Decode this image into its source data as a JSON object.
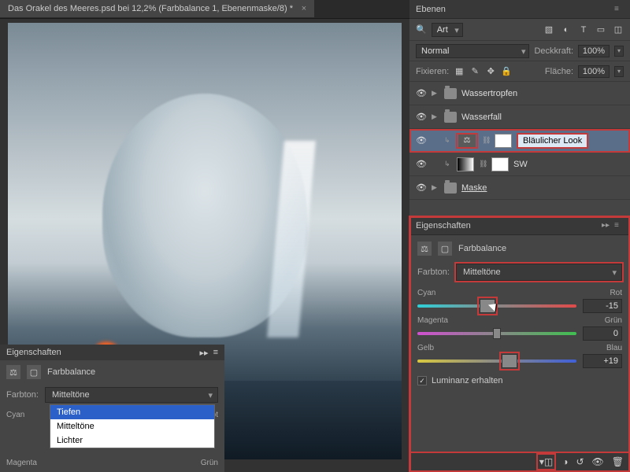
{
  "doc": {
    "title": "Das Orakel des Meeres.psd bei 12,2% (Farbbalance 1, Ebenenmaske/8) *",
    "close": "×"
  },
  "layers": {
    "panel_title": "Ebenen",
    "kind_dd": "Art",
    "blend": "Normal",
    "opacity_lbl": "Deckkraft:",
    "opacity": "100%",
    "lock_lbl": "Fixieren:",
    "fill_lbl": "Fläche:",
    "fill": "100%",
    "items": [
      {
        "name": "Wassertropfen"
      },
      {
        "name": "Wasserfall"
      },
      {
        "name": "Bläulicher Look"
      },
      {
        "name": "SW"
      },
      {
        "name": "Maske"
      }
    ]
  },
  "props": {
    "panel_title": "Eigenschaften",
    "adj_title": "Farbbalance",
    "tone_lbl": "Farbton:",
    "tone_val": "Mitteltöne",
    "sliders": [
      {
        "left": "Cyan",
        "right": "Rot",
        "val": "-15",
        "pos": 44,
        "track": "t-cyan",
        "red": true,
        "cursor": true
      },
      {
        "left": "Magenta",
        "right": "Grün",
        "val": "0",
        "pos": 50,
        "track": "t-mag"
      },
      {
        "left": "Gelb",
        "right": "Blau",
        "val": "+19",
        "pos": 58,
        "track": "t-yel",
        "red": true
      }
    ],
    "lum": "Luminanz erhalten"
  },
  "bl": {
    "panel_title": "Eigenschaften",
    "adj_title": "Farbbalance",
    "tone_lbl": "Farbton:",
    "tone_val": "Mitteltöne",
    "opts": [
      "Tiefen",
      "Mitteltöne",
      "Lichter"
    ],
    "s1l": "Cyan",
    "s1r": "Rot",
    "s2l": "Magenta",
    "s2r": "Grün"
  },
  "ic": {
    "search": "🔍"
  }
}
